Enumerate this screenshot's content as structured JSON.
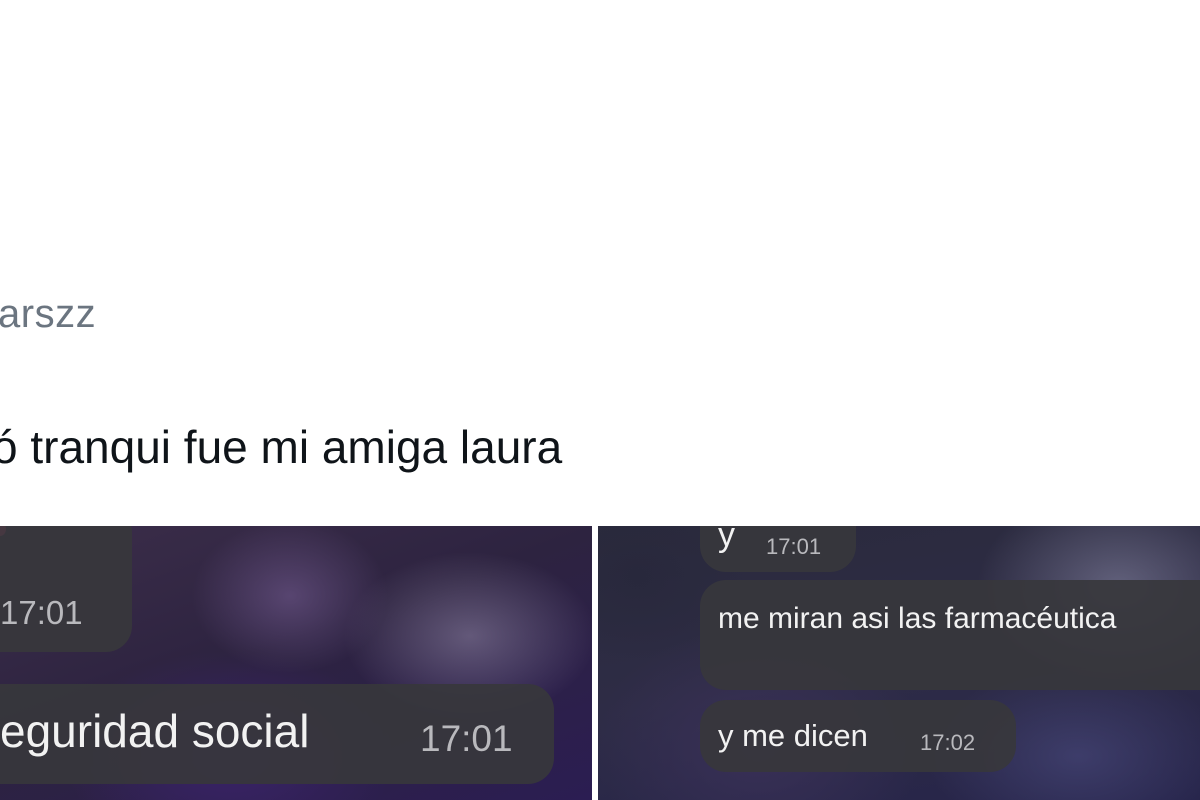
{
  "tweet": {
    "handle": "arszz",
    "text": "ó tranqui fue mi amiga laura"
  },
  "media": {
    "left_panel": {
      "messages": [
        {
          "text": "",
          "time": "17:01"
        },
        {
          "text": "eguridad social",
          "time": "17:01"
        }
      ]
    },
    "right_panel": {
      "messages": [
        {
          "text": "y",
          "time": "17:01"
        },
        {
          "text": "me miran asi las farmacéutica",
          "time": ""
        },
        {
          "text": "y me dicen",
          "time": "17:02"
        }
      ]
    }
  },
  "colors": {
    "handle_text": "#6b7580",
    "tweet_text": "#0f1419",
    "bubble_bg": "#37373c",
    "accent_dot": "#e8407a"
  }
}
